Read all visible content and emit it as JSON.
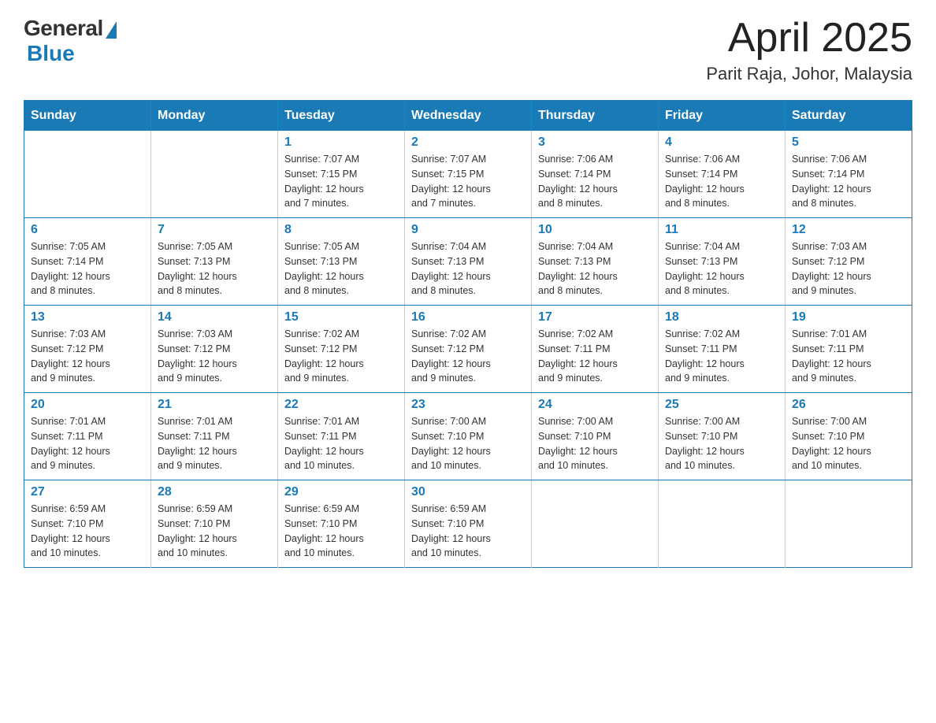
{
  "header": {
    "logo_general": "General",
    "logo_blue": "Blue",
    "title": "April 2025",
    "location": "Parit Raja, Johor, Malaysia"
  },
  "calendar": {
    "days_of_week": [
      "Sunday",
      "Monday",
      "Tuesday",
      "Wednesday",
      "Thursday",
      "Friday",
      "Saturday"
    ],
    "weeks": [
      [
        {
          "day": "",
          "info": ""
        },
        {
          "day": "",
          "info": ""
        },
        {
          "day": "1",
          "info": "Sunrise: 7:07 AM\nSunset: 7:15 PM\nDaylight: 12 hours\nand 7 minutes."
        },
        {
          "day": "2",
          "info": "Sunrise: 7:07 AM\nSunset: 7:15 PM\nDaylight: 12 hours\nand 7 minutes."
        },
        {
          "day": "3",
          "info": "Sunrise: 7:06 AM\nSunset: 7:14 PM\nDaylight: 12 hours\nand 8 minutes."
        },
        {
          "day": "4",
          "info": "Sunrise: 7:06 AM\nSunset: 7:14 PM\nDaylight: 12 hours\nand 8 minutes."
        },
        {
          "day": "5",
          "info": "Sunrise: 7:06 AM\nSunset: 7:14 PM\nDaylight: 12 hours\nand 8 minutes."
        }
      ],
      [
        {
          "day": "6",
          "info": "Sunrise: 7:05 AM\nSunset: 7:14 PM\nDaylight: 12 hours\nand 8 minutes."
        },
        {
          "day": "7",
          "info": "Sunrise: 7:05 AM\nSunset: 7:13 PM\nDaylight: 12 hours\nand 8 minutes."
        },
        {
          "day": "8",
          "info": "Sunrise: 7:05 AM\nSunset: 7:13 PM\nDaylight: 12 hours\nand 8 minutes."
        },
        {
          "day": "9",
          "info": "Sunrise: 7:04 AM\nSunset: 7:13 PM\nDaylight: 12 hours\nand 8 minutes."
        },
        {
          "day": "10",
          "info": "Sunrise: 7:04 AM\nSunset: 7:13 PM\nDaylight: 12 hours\nand 8 minutes."
        },
        {
          "day": "11",
          "info": "Sunrise: 7:04 AM\nSunset: 7:13 PM\nDaylight: 12 hours\nand 8 minutes."
        },
        {
          "day": "12",
          "info": "Sunrise: 7:03 AM\nSunset: 7:12 PM\nDaylight: 12 hours\nand 9 minutes."
        }
      ],
      [
        {
          "day": "13",
          "info": "Sunrise: 7:03 AM\nSunset: 7:12 PM\nDaylight: 12 hours\nand 9 minutes."
        },
        {
          "day": "14",
          "info": "Sunrise: 7:03 AM\nSunset: 7:12 PM\nDaylight: 12 hours\nand 9 minutes."
        },
        {
          "day": "15",
          "info": "Sunrise: 7:02 AM\nSunset: 7:12 PM\nDaylight: 12 hours\nand 9 minutes."
        },
        {
          "day": "16",
          "info": "Sunrise: 7:02 AM\nSunset: 7:12 PM\nDaylight: 12 hours\nand 9 minutes."
        },
        {
          "day": "17",
          "info": "Sunrise: 7:02 AM\nSunset: 7:11 PM\nDaylight: 12 hours\nand 9 minutes."
        },
        {
          "day": "18",
          "info": "Sunrise: 7:02 AM\nSunset: 7:11 PM\nDaylight: 12 hours\nand 9 minutes."
        },
        {
          "day": "19",
          "info": "Sunrise: 7:01 AM\nSunset: 7:11 PM\nDaylight: 12 hours\nand 9 minutes."
        }
      ],
      [
        {
          "day": "20",
          "info": "Sunrise: 7:01 AM\nSunset: 7:11 PM\nDaylight: 12 hours\nand 9 minutes."
        },
        {
          "day": "21",
          "info": "Sunrise: 7:01 AM\nSunset: 7:11 PM\nDaylight: 12 hours\nand 9 minutes."
        },
        {
          "day": "22",
          "info": "Sunrise: 7:01 AM\nSunset: 7:11 PM\nDaylight: 12 hours\nand 10 minutes."
        },
        {
          "day": "23",
          "info": "Sunrise: 7:00 AM\nSunset: 7:10 PM\nDaylight: 12 hours\nand 10 minutes."
        },
        {
          "day": "24",
          "info": "Sunrise: 7:00 AM\nSunset: 7:10 PM\nDaylight: 12 hours\nand 10 minutes."
        },
        {
          "day": "25",
          "info": "Sunrise: 7:00 AM\nSunset: 7:10 PM\nDaylight: 12 hours\nand 10 minutes."
        },
        {
          "day": "26",
          "info": "Sunrise: 7:00 AM\nSunset: 7:10 PM\nDaylight: 12 hours\nand 10 minutes."
        }
      ],
      [
        {
          "day": "27",
          "info": "Sunrise: 6:59 AM\nSunset: 7:10 PM\nDaylight: 12 hours\nand 10 minutes."
        },
        {
          "day": "28",
          "info": "Sunrise: 6:59 AM\nSunset: 7:10 PM\nDaylight: 12 hours\nand 10 minutes."
        },
        {
          "day": "29",
          "info": "Sunrise: 6:59 AM\nSunset: 7:10 PM\nDaylight: 12 hours\nand 10 minutes."
        },
        {
          "day": "30",
          "info": "Sunrise: 6:59 AM\nSunset: 7:10 PM\nDaylight: 12 hours\nand 10 minutes."
        },
        {
          "day": "",
          "info": ""
        },
        {
          "day": "",
          "info": ""
        },
        {
          "day": "",
          "info": ""
        }
      ]
    ]
  }
}
